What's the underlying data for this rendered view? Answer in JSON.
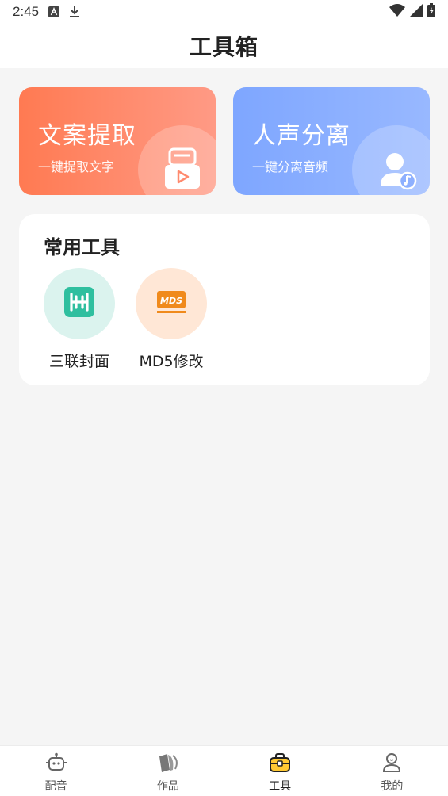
{
  "status_bar": {
    "time": "2:45",
    "icons": [
      "font-a-icon",
      "download-icon",
      "wifi-icon",
      "signal-icon",
      "battery-icon"
    ]
  },
  "header": {
    "title": "工具箱"
  },
  "feature_cards": [
    {
      "title": "文案提取",
      "subtitle": "一键提取文字",
      "icon": "video-box-icon",
      "color_from": "#ff7a52",
      "color_to": "#ff9a85"
    },
    {
      "title": "人声分离",
      "subtitle": "一键分离音频",
      "icon": "person-music-icon",
      "color_from": "#7ea6ff",
      "color_to": "#98b8ff"
    }
  ],
  "tools_section": {
    "title": "常用工具",
    "items": [
      {
        "label": "三联封面",
        "icon": "triple-cover-icon",
        "bg": "#dbf3ee",
        "accent": "#2fbf9f"
      },
      {
        "label": "MD5修改",
        "icon": "md5-icon",
        "icon_text": "MDS",
        "bg": "#ffe7d6",
        "accent": "#f08a1c"
      }
    ]
  },
  "tabbar": {
    "active": 2,
    "items": [
      {
        "label": "配音",
        "icon": "robot-icon"
      },
      {
        "label": "作品",
        "icon": "works-icon"
      },
      {
        "label": "工具",
        "icon": "toolbox-icon"
      },
      {
        "label": "我的",
        "icon": "profile-icon"
      }
    ]
  }
}
